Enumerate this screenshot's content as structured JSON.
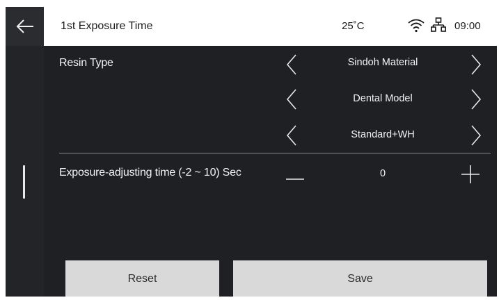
{
  "header": {
    "title": "1st Exposure Time",
    "temperature": "25˚C",
    "time": "09:00",
    "icons": [
      "back-arrow-icon",
      "wifi-icon",
      "network-icon"
    ]
  },
  "resin": {
    "label": "Resin Type",
    "options": [
      {
        "value": "Sindoh Material"
      },
      {
        "value": "Dental Model"
      },
      {
        "value": "Standard+WH"
      }
    ]
  },
  "exposure": {
    "label": "Exposure-adjusting time  (-2 ~ 10) Sec",
    "value": "0"
  },
  "buttons": {
    "reset": "Reset",
    "save": "Save"
  },
  "colors": {
    "panel": "#1f2024",
    "rail": "#232427",
    "button": "#d9d9da"
  }
}
